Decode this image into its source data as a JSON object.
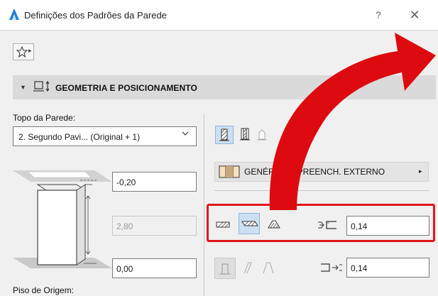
{
  "window": {
    "title": "Definições dos Padrões da Parede",
    "help_glyph": "?",
    "close_glyph": "✕"
  },
  "toolbar": {
    "favorites_icon": "star-icon",
    "favorites_arrow": "▸"
  },
  "section": {
    "arrow": "▼",
    "icon": "geometry-icon",
    "title": "GEOMETRIA E POSICIONAMENTO"
  },
  "left_panel": {
    "top_label": "Topo da Parede:",
    "top_dropdown_value": "2. Segundo Pavi... (Original + 1)",
    "top_offset_value": "-0,20",
    "height_value": "2,80",
    "base_offset_value": "0,00",
    "home_story_label": "Piso de Origem:"
  },
  "right_panel": {
    "building_material": "GENÉRICO - PREENCH. EXTERNO",
    "building_material_arrow": "▸",
    "thickness_value": "0,14",
    "bottom_thickness_value": "0,14"
  },
  "colors": {
    "highlight": "#e0161b",
    "arrow": "#dd0a10",
    "selected_bg": "#cde0f2"
  }
}
